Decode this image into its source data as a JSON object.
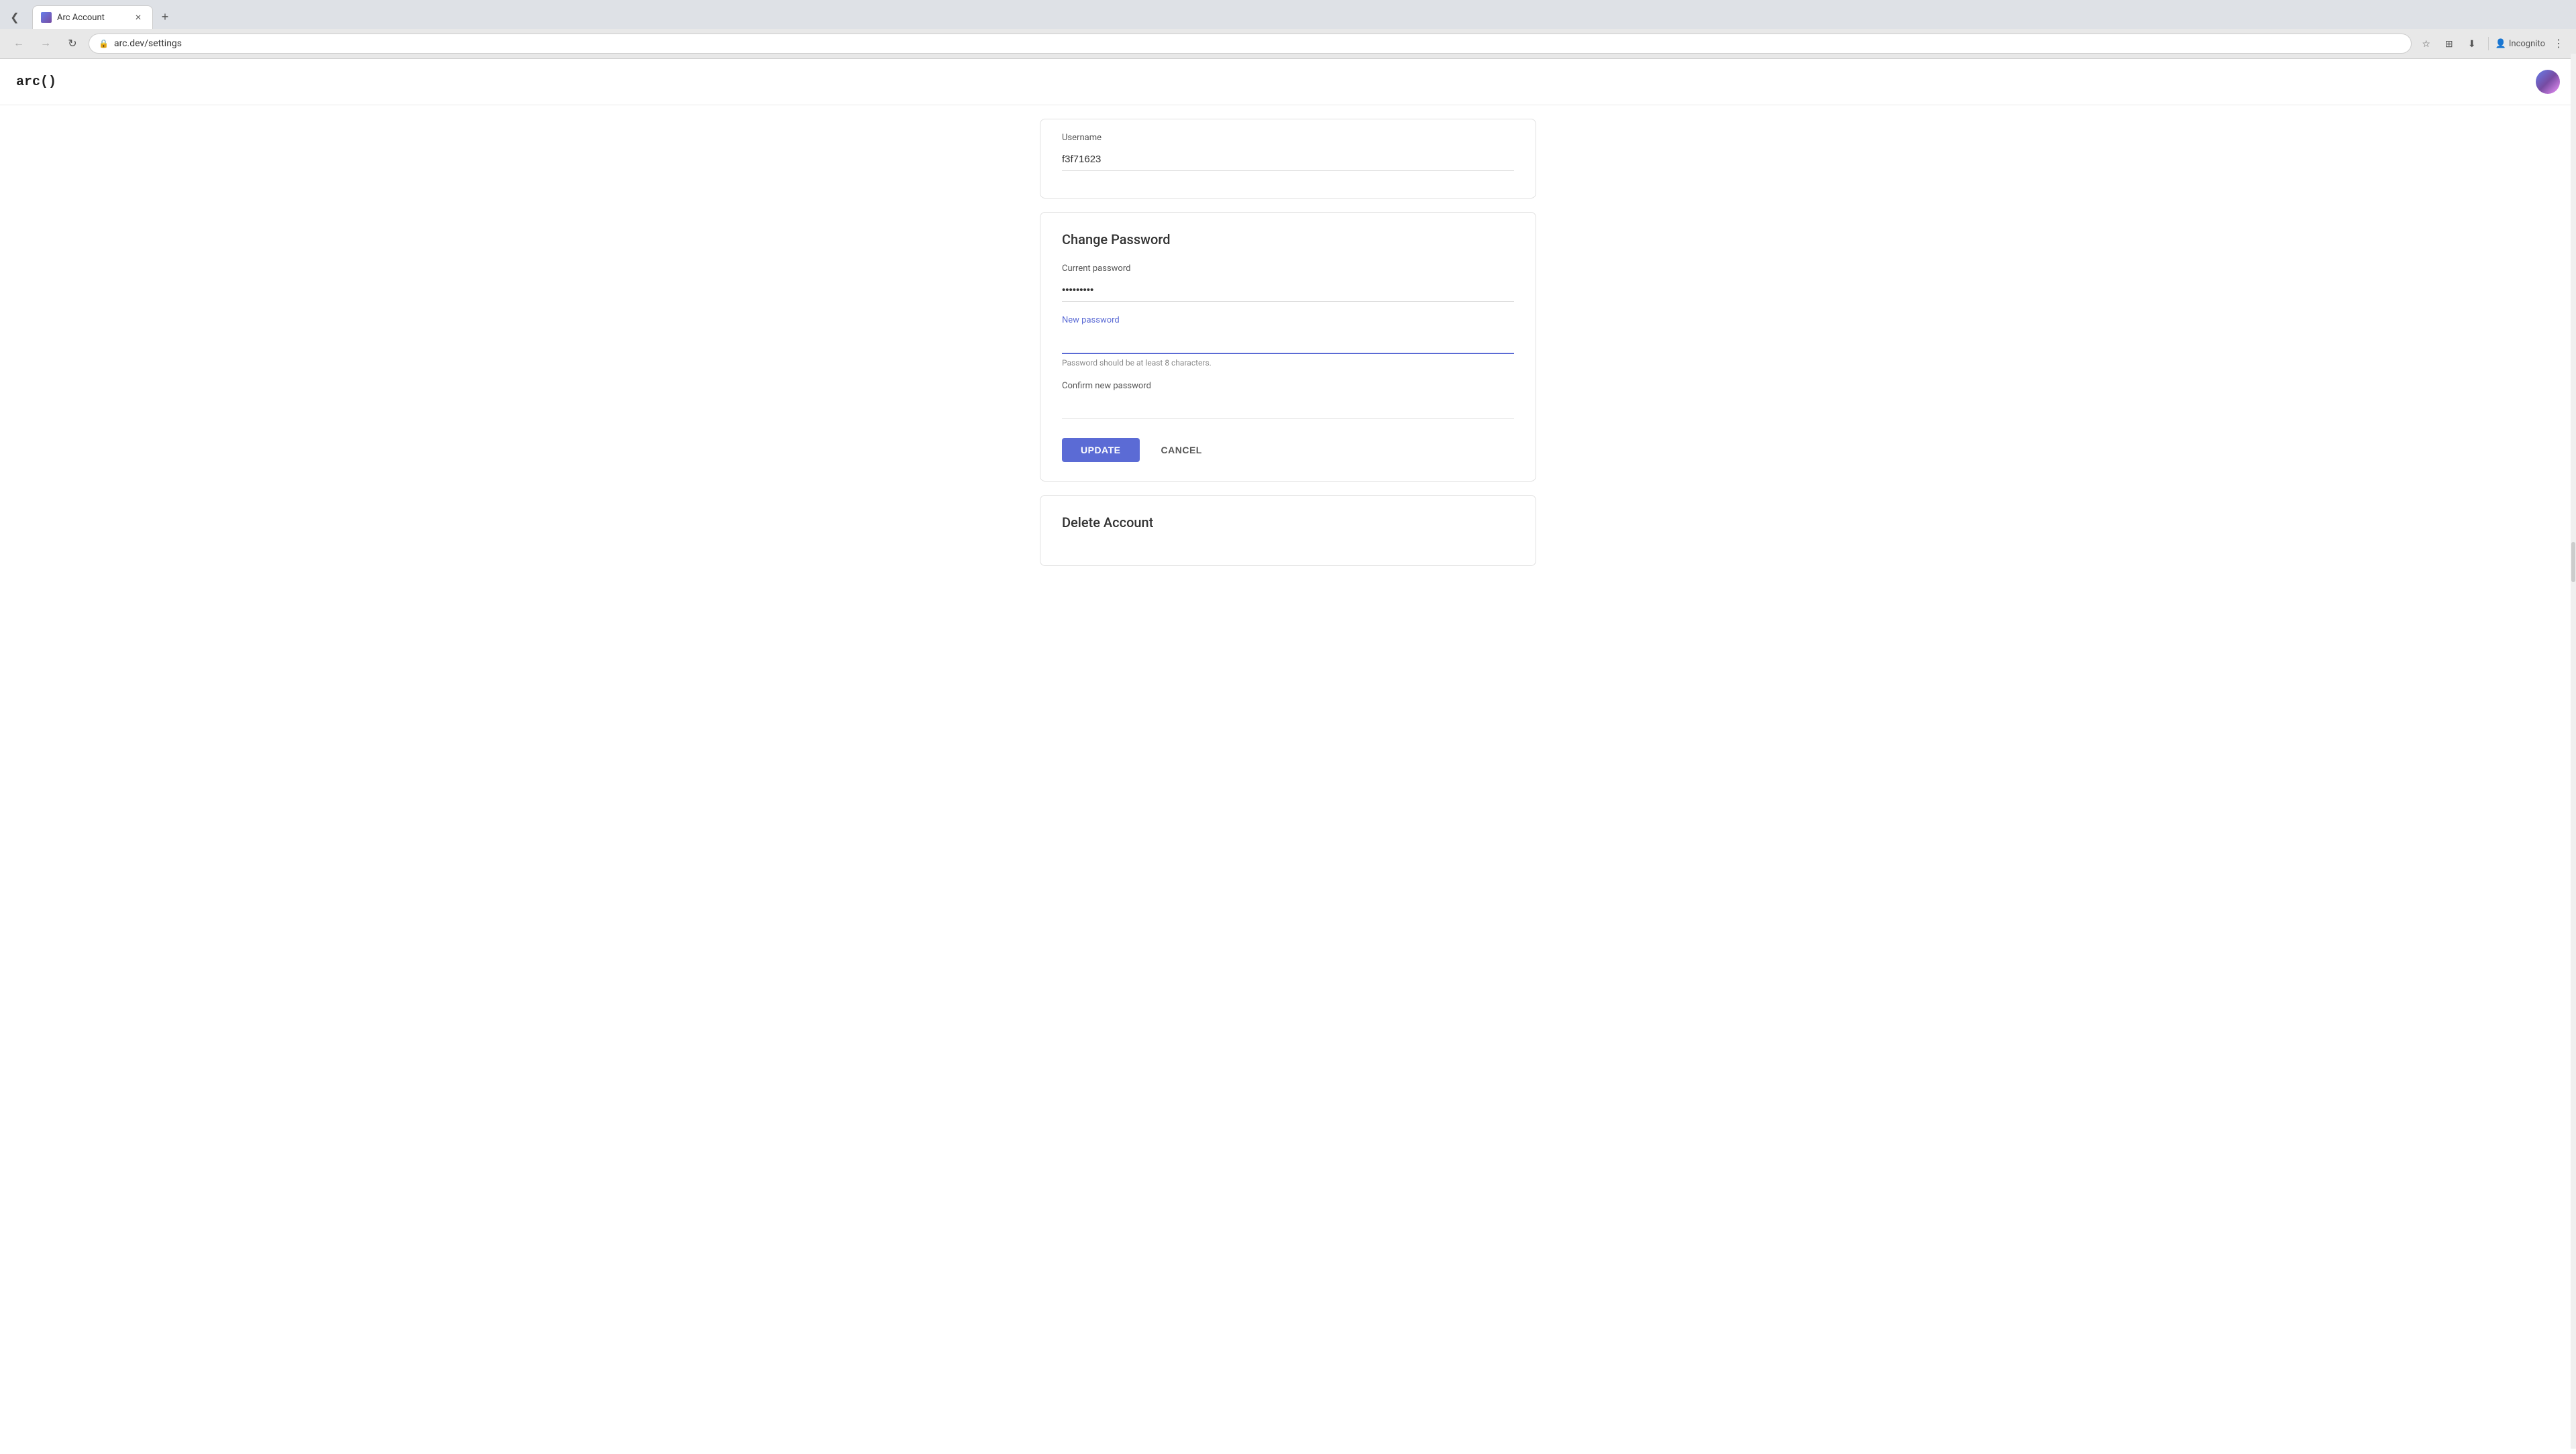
{
  "browser": {
    "tab_controls": {
      "prev_icon": "❮",
      "next_icon": "+",
      "close_icon": "✕"
    },
    "tab": {
      "title": "Arc Account",
      "favicon_color": "#5b6bd5"
    },
    "new_tab_icon": "+",
    "nav": {
      "back_icon": "←",
      "forward_icon": "→",
      "refresh_icon": "↻"
    },
    "address": {
      "url": "arc.dev/settings",
      "lock_icon": "🔒"
    },
    "toolbar": {
      "bookmark_icon": "☆",
      "extensions_icon": "⊞",
      "download_icon": "⬇",
      "incognito_label": "Incognito",
      "incognito_icon": "👤",
      "menu_icon": "⋮"
    }
  },
  "app": {
    "logo": "arc()",
    "avatar_alt": "User avatar"
  },
  "username_section": {
    "label": "Username",
    "value": "f3f71623"
  },
  "change_password_section": {
    "title": "Change Password",
    "current_password_label": "Current password",
    "current_password_value": "•••••••••",
    "new_password_label": "New password",
    "new_password_value": "",
    "new_password_placeholder": "",
    "helper_text": "Password should be at least 8 characters.",
    "confirm_password_label": "Confirm new password",
    "confirm_password_value": "",
    "update_button_label": "UPDATE",
    "cancel_button_label": "CANCEL"
  },
  "delete_account_section": {
    "title": "Delete Account"
  }
}
